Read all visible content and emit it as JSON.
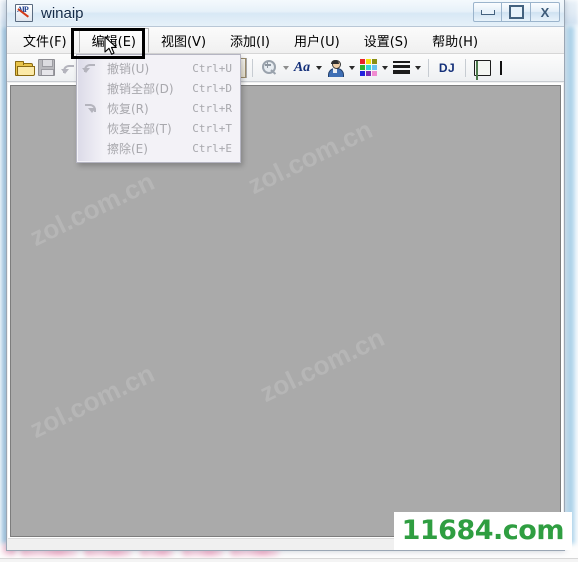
{
  "window": {
    "title": "winaip",
    "app_icon": "winaip-app-icon",
    "controls": {
      "minimize": "minimize-button",
      "maximize": "maximize-restore-button",
      "close_label": "X"
    }
  },
  "menubar": {
    "items": [
      {
        "label": "文件(F)",
        "name": "menu-file",
        "open": false
      },
      {
        "label": "编辑(E)",
        "name": "menu-edit",
        "open": true
      },
      {
        "label": "视图(V)",
        "name": "menu-view",
        "open": false
      },
      {
        "label": "添加(I)",
        "name": "menu-add",
        "open": false
      },
      {
        "label": "用户(U)",
        "name": "menu-user",
        "open": false
      },
      {
        "label": "设置(S)",
        "name": "menu-settings",
        "open": false
      },
      {
        "label": "帮助(H)",
        "name": "menu-help",
        "open": false
      }
    ]
  },
  "edit_menu": {
    "items": [
      {
        "label": "撤销(U)",
        "accel": "Ctrl+U",
        "icon": "undo-arrow-icon",
        "disabled": true
      },
      {
        "label": "撤销全部(D)",
        "accel": "Ctrl+D",
        "icon": "none",
        "disabled": true
      },
      {
        "label": "恢复(R)",
        "accel": "Ctrl+R",
        "icon": "redo-arrow-icon",
        "disabled": true
      },
      {
        "label": "恢复全部(T)",
        "accel": "Ctrl+T",
        "icon": "none",
        "disabled": true
      },
      {
        "label": "擦除(E)",
        "accel": "Ctrl+E",
        "icon": "none",
        "disabled": true
      }
    ]
  },
  "toolbar": {
    "open_icon": "open-folder-icon",
    "save_icon": "save-floppy-icon",
    "combo_value": "",
    "zoom_icon": "zoom-magnifier-icon",
    "font_icon_label": "Aa",
    "person_icon": "person-icon",
    "colors_icon": "color-palette-icon",
    "palette": [
      "#e8252a",
      "#f2e30f",
      "#8a8f14",
      "#2db52d",
      "#2fd6d6",
      "#66c2f0",
      "#2020dd",
      "#7a2bb5",
      "#f08ad0"
    ],
    "lines_icon": "line-thickness-icon",
    "dj_label": "DJ",
    "doc_icon": "document-properties-icon",
    "text-cursor_icon": "text-cursor-icon"
  },
  "canvas": {
    "watermarks": [
      "zol.com.cn",
      "zol.com.cn",
      "zol.com.cn",
      "zol.com.cn"
    ],
    "background_color": "#aaaaaa"
  },
  "overlay": {
    "annotation_box": "edit-menu-annotation-highlight",
    "cursor": "mouse-pointer-cursor"
  },
  "watermark": {
    "text": "11684.com",
    "color": "#2f9e41"
  }
}
